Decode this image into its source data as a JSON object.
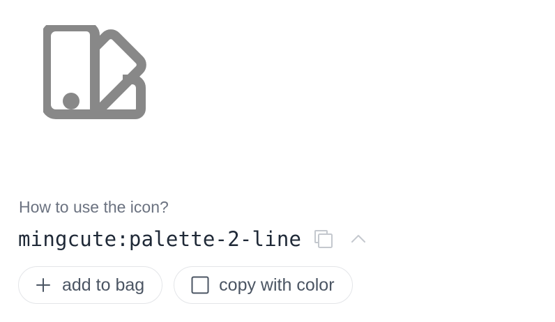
{
  "preview": {
    "icon": "palette-2-icon",
    "color": "#888888"
  },
  "usage": {
    "question": "How to use the icon?",
    "icon_name": "mingcute:palette-2-line",
    "copy_icon": "copy-icon",
    "toggle_icon": "chevron-up-icon"
  },
  "actions": {
    "add_to_bag_label": "add to bag",
    "add_icon": "plus-icon",
    "copy_with_color_label": "copy with color",
    "copy_with_color_checked": false
  },
  "colors": {
    "question_text": "#6b7280",
    "name_text": "#1f2937",
    "button_text": "#4b5563",
    "button_border": "#e3e5e8",
    "muted_icon": "#c4c8ce"
  }
}
